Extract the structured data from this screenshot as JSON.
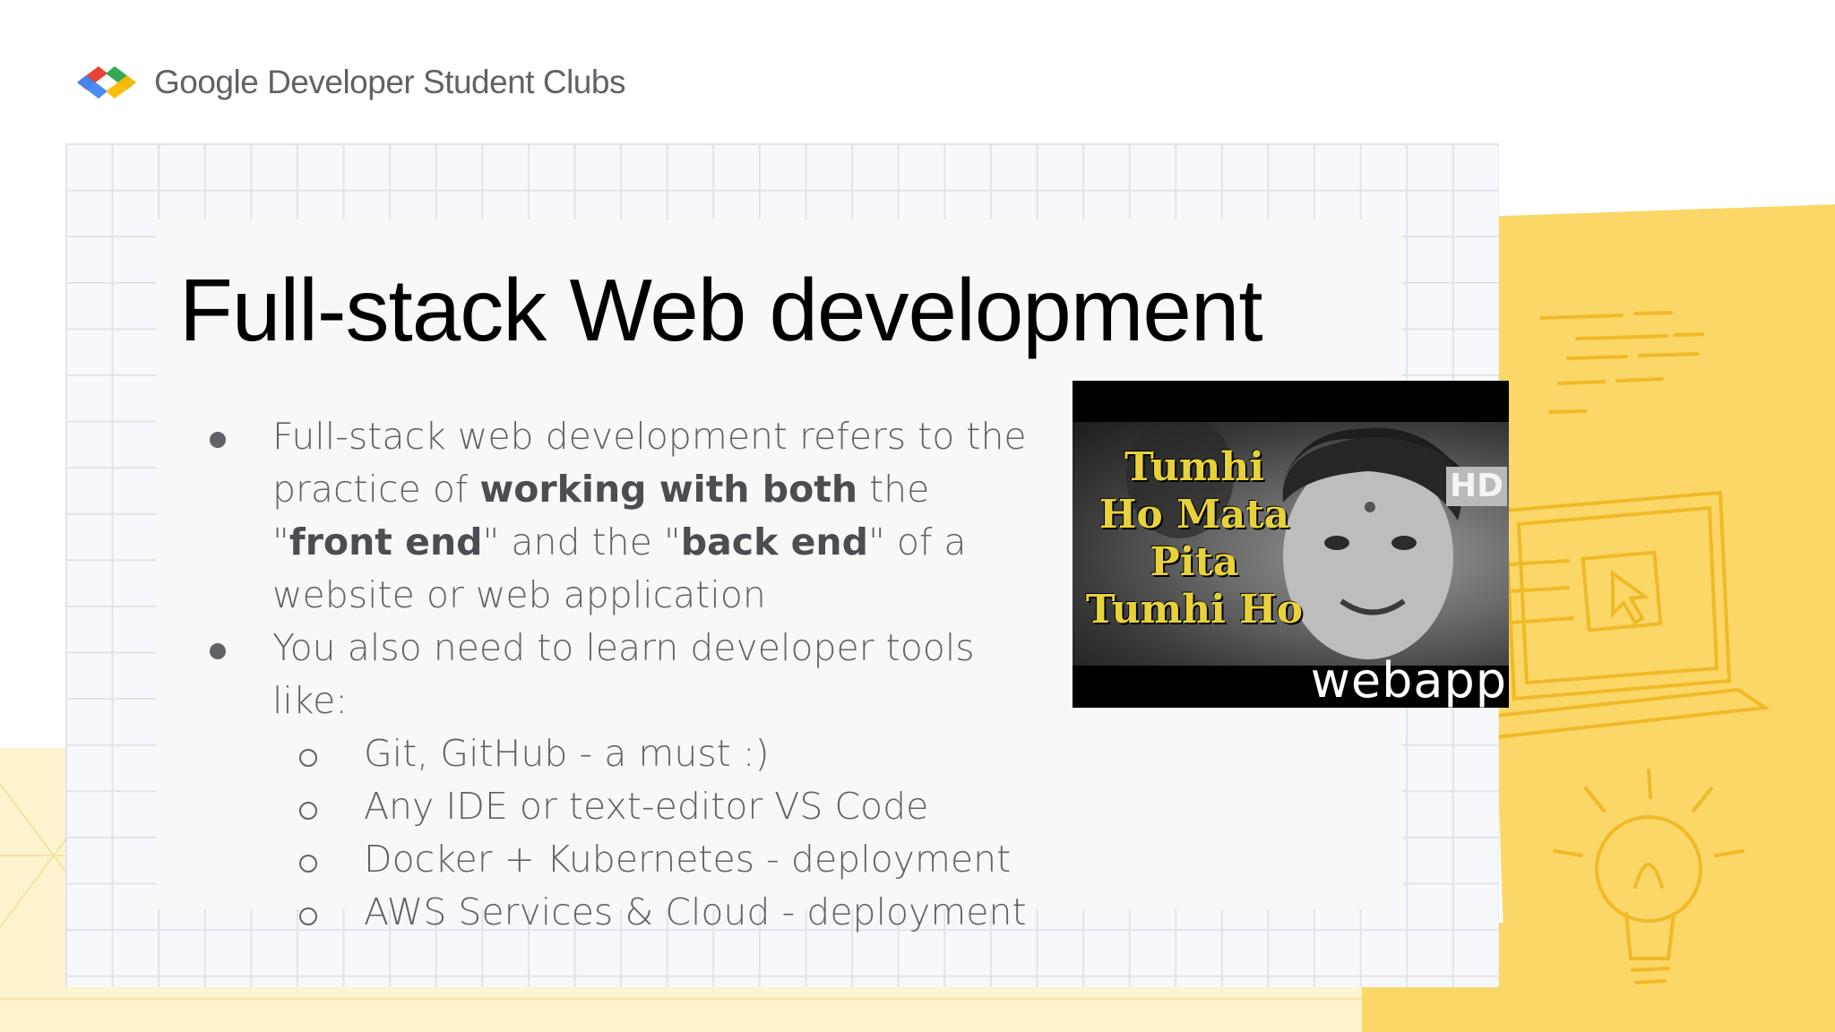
{
  "header": {
    "logo_text": "Google Developer Student Clubs",
    "logo_colors": {
      "red": "#ea4335",
      "blue": "#4285f4",
      "green": "#34a853",
      "yellow": "#fbbc04"
    }
  },
  "slide": {
    "title": "Full-stack Web development",
    "bullets": [
      {
        "parts": {
          "t1": "Full-stack web development refers to the practice of ",
          "b1": "working with both",
          "t2": " the \"",
          "b2": "front end",
          "t3": "\" and the \"",
          "b3": "back end",
          "t4": "\" of a website or web application"
        }
      },
      {
        "text": "You also need to learn developer tools like:",
        "sub": [
          "Git, GitHub - a must :)",
          "Any IDE or text-editor VS Code",
          "Docker + Kubernetes - deployment",
          "AWS Services & Cloud - deployment"
        ]
      }
    ]
  },
  "video_thumbnail": {
    "caption_lines": [
      "Tumhi",
      "Ho Mata",
      "Pita",
      "Tumhi Ho"
    ],
    "badge": "HD",
    "watermark": "webapp"
  },
  "colors": {
    "accent_yellow": "#fbd767",
    "text_gray": "#5f6368",
    "title": "#000000"
  }
}
